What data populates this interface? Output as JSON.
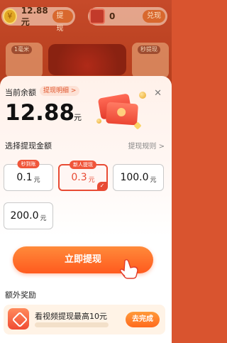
{
  "background": {
    "coin_icon": "¥",
    "coin_value": "12.88元",
    "coin_button": "提现",
    "cash_value": "0",
    "cash_button": "兑现",
    "card_left_tag": "1毫米",
    "card_right_tag": "秒提现"
  },
  "sheet": {
    "balance_label": "当前余额",
    "detail_link": "提现明细 >",
    "balance_amount": "12.88",
    "balance_unit": "元",
    "close_icon": "✕",
    "section_title": "选择提现金额",
    "rules_link": "提现规则 >",
    "amount_options": [
      {
        "value": "0.1",
        "unit": "元",
        "badge": "秒到账",
        "selected": false
      },
      {
        "value": "0.3",
        "unit": "元",
        "badge": "新人提现",
        "selected": true
      },
      {
        "value": "100.0",
        "unit": "元",
        "badge": "",
        "selected": false
      },
      {
        "value": "200.0",
        "unit": "元",
        "badge": "",
        "selected": false
      }
    ],
    "check_mark": "✓",
    "withdraw_button": "立即提现",
    "extra_title": "额外奖励",
    "task": {
      "text": "看视频提现最高10元",
      "button": "去完成"
    }
  },
  "colors": {
    "accent": "#e84b34",
    "button_gradient_top": "#ff8a3a",
    "button_gradient_bottom": "#ff5a1e"
  }
}
